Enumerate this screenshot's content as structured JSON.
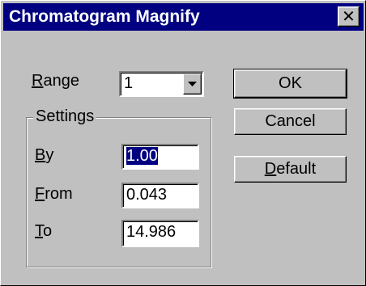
{
  "window": {
    "title": "Chromatogram Magnify",
    "close_glyph": "✕"
  },
  "range": {
    "label_mnemonic": "R",
    "label_rest": "ange",
    "value": "1"
  },
  "settings": {
    "group_label": "Settings",
    "by": {
      "label_mnemonic": "B",
      "label_rest": "y",
      "value": "1.00"
    },
    "from": {
      "label_mnemonic": "F",
      "label_rest": "rom",
      "value": "0.043"
    },
    "to": {
      "label_mnemonic": "T",
      "label_rest": "o",
      "value": "14.986"
    }
  },
  "buttons": {
    "ok": "OK",
    "cancel": "Cancel",
    "default_mnemonic": "D",
    "default_rest": "efault"
  },
  "colors": {
    "face": "#c0c0c0",
    "titlebar": "#000080",
    "selection": "#000080"
  }
}
